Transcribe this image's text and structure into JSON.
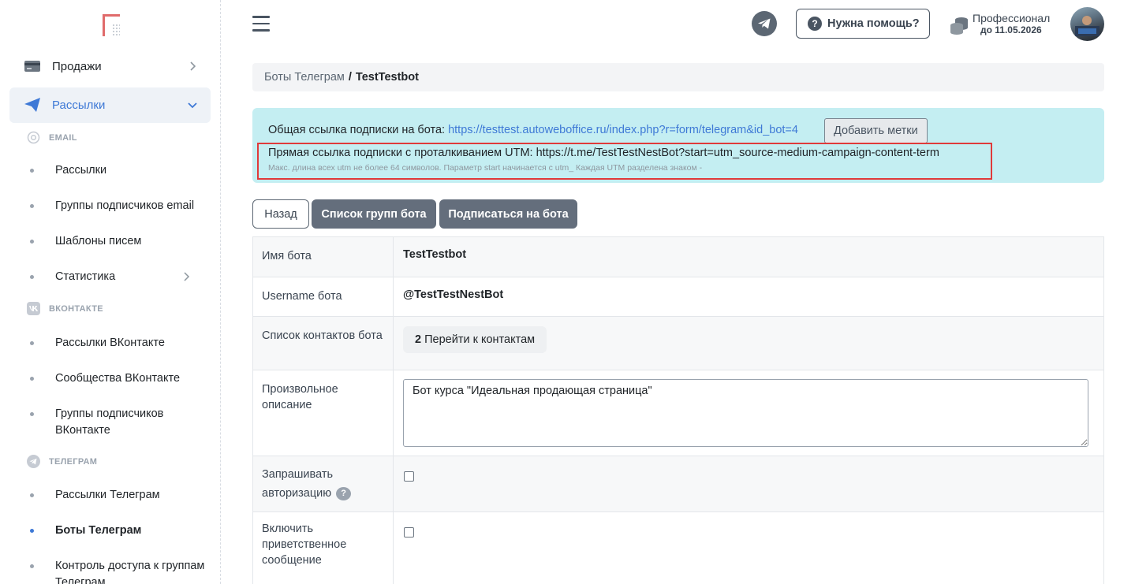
{
  "sidebar": {
    "sales": "Продажи",
    "mailings": "Рассылки",
    "sections": {
      "email": "EMAIL",
      "vk": "ВКОНТАКТЕ",
      "telegram": "ТЕЛЕГРАМ"
    },
    "items": {
      "email_mailings": "Рассылки",
      "email_groups": "Группы подписчиков email",
      "templates": "Шаблоны писем",
      "stats": "Статистика",
      "vk_mailings": "Рассылки ВКонтакте",
      "vk_communities": "Сообщества ВКонтакте",
      "vk_groups": "Группы подписчиков ВКонтакте",
      "tg_mailings": "Рассылки Телеграм",
      "tg_bots": "Боты Телеграм",
      "tg_access": "Контроль доступа к группам Телеграм"
    }
  },
  "header": {
    "help": "Нужна помощь?",
    "plan_name": "Профессионал",
    "plan_until": "до 11.05.2026"
  },
  "breadcrumb": {
    "parent": "Боты Телеграм",
    "separator": "/",
    "current": "TestTestbot"
  },
  "info": {
    "common_label": "Общая ссылка подписки на бота:",
    "common_url": "https://testtest.autoweboffice.ru/index.php?r=form/telegram&id_bot=4",
    "add_tags": "Добавить метки",
    "direct_text": "Прямая ссылка подписки с проталкиванием UTM: https://t.me/TestTestNestBot?start=utm_source-medium-campaign-content-term",
    "hint": "Макс. длина всех utm не более 64 символов. Параметр start начинается с utm_ Каждая UTM разделена знаком -"
  },
  "buttons": {
    "back": "Назад",
    "groups": "Список групп бота",
    "subscribe": "Подписаться на бота"
  },
  "table": {
    "bot_name_label": "Имя бота",
    "bot_name_value": "TestTestbot",
    "username_label": "Username бота",
    "username_value": "@TestTestNestBot",
    "contacts_label": "Список контактов бота",
    "contacts_count": "2",
    "contacts_link": "Перейти к контактам",
    "description_label": "Произвольное описание",
    "description_value": "Бот курса \"Идеальная продающая страница\"",
    "auth_label": "Запрашивать авторизацию",
    "welcome_label": "Включить приветственное сообщение"
  },
  "colors": {
    "accent": "#3e79d6",
    "info_bg": "#c4eef2",
    "highlight": "#e03a3a"
  }
}
